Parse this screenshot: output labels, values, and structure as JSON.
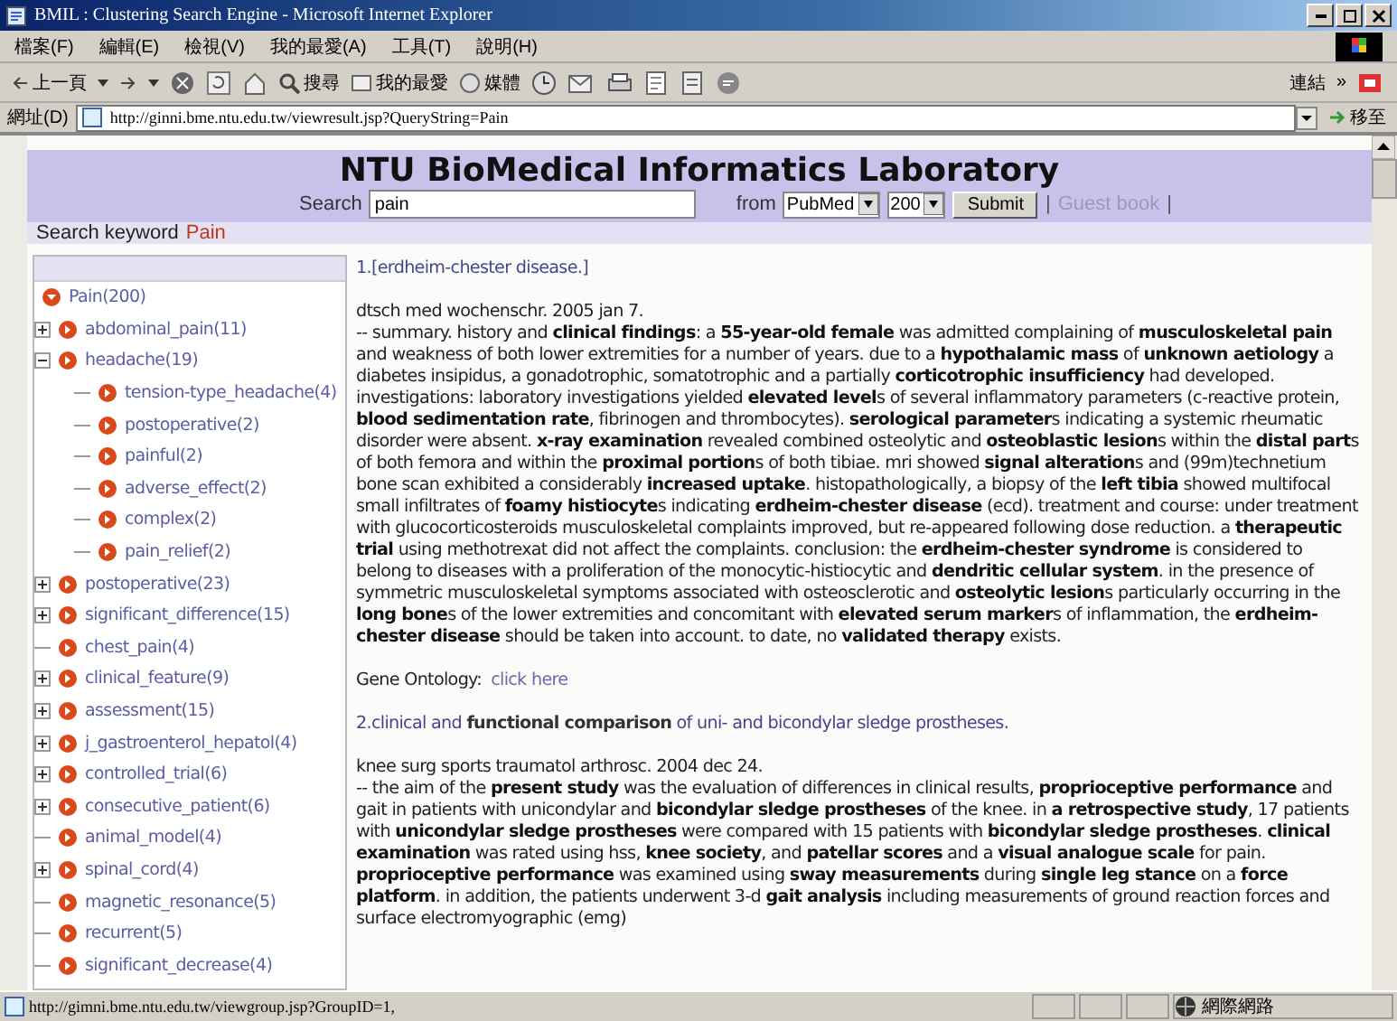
{
  "window": {
    "title": "BMIL : Clustering Search Engine - Microsoft Internet Explorer"
  },
  "menu": [
    "檔案(F)",
    "編輯(E)",
    "檢視(V)",
    "我的最愛(A)",
    "工具(T)",
    "說明(H)"
  ],
  "toolbar": {
    "back": "上一頁",
    "search": "搜尋",
    "favorites": "我的最愛",
    "media": "媒體",
    "links": "連結",
    "more": "»"
  },
  "address": {
    "label": "網址(D)",
    "url": "http://ginni.bme.ntu.edu.tw/viewresult.jsp?QueryString=Pain",
    "go": "移至"
  },
  "header": {
    "title": "NTU BioMedical Informatics Laboratory",
    "search_label": "Search",
    "search_value": "pain",
    "from_label": "from",
    "source": "PubMed",
    "count": "200",
    "submit": "Submit",
    "divider_left": "|",
    "guest_book": "Guest book",
    "divider_right": "|"
  },
  "keyword": {
    "label": "Search keyword",
    "value": "Pain"
  },
  "tree": [
    {
      "label": "Pain(200)",
      "kind": "root",
      "expanded": true,
      "children": [
        {
          "label": "abdominal_pain(11)",
          "kind": "group",
          "expanded": false
        },
        {
          "label": "headache(19)",
          "kind": "group",
          "expanded": true,
          "children": [
            {
              "label": "tension-type_headache(4)",
              "kind": "leaf"
            },
            {
              "label": "postoperative(2)",
              "kind": "leaf"
            },
            {
              "label": "painful(2)",
              "kind": "leaf"
            },
            {
              "label": "adverse_effect(2)",
              "kind": "leaf"
            },
            {
              "label": "complex(2)",
              "kind": "leaf"
            },
            {
              "label": "pain_relief(2)",
              "kind": "leaf"
            }
          ]
        },
        {
          "label": "postoperative(23)",
          "kind": "group",
          "expanded": false
        },
        {
          "label": "significant_difference(15)",
          "kind": "group",
          "expanded": false
        },
        {
          "label": "chest_pain(4)",
          "kind": "leaf"
        },
        {
          "label": "clinical_feature(9)",
          "kind": "group",
          "expanded": false
        },
        {
          "label": "assessment(15)",
          "kind": "group",
          "expanded": false
        },
        {
          "label": "j_gastroenterol_hepatol(4)",
          "kind": "group",
          "expanded": false
        },
        {
          "label": "controlled_trial(6)",
          "kind": "group",
          "expanded": false
        },
        {
          "label": "consecutive_patient(6)",
          "kind": "group",
          "expanded": false
        },
        {
          "label": "animal_model(4)",
          "kind": "leaf"
        },
        {
          "label": "spinal_cord(4)",
          "kind": "group",
          "expanded": false
        },
        {
          "label": "magnetic_resonance(5)",
          "kind": "leaf"
        },
        {
          "label": "recurrent(5)",
          "kind": "leaf"
        },
        {
          "label": "significant_decrease(4)",
          "kind": "leaf"
        }
      ]
    }
  ],
  "results": [
    {
      "title": "1.[erdheim-chester disease.]",
      "source": "dtsch med wochenschr. 2005 jan 7.",
      "abstract": "-- summary. history and **clinical findings**: a **55-year-old female** was admitted complaining of **musculoskeletal pain** and weakness of both lower extremities for a number of years. due to a **hypothalamic mass** of **unknown aetiology** a diabetes insipidus, a gonadotrophic, somatotrophic and a partially **corticotrophic insufficiency** had developed. investigations: laboratory investigations yielded **elevated level**s of several inflammatory parameters (c-reactive protein, **blood sedimentation rate**, fibrinogen and thrombocytes). **serological parameter**s indicating a systemic rheumatic disorder were absent. **x-ray examination** revealed combined osteolytic and **osteoblastic lesion**s within the **distal part**s of both femora and within the **proximal portion**s of both tibiae. mri showed **signal alteration**s and (99m)technetium bone scan exhibited a considerably **increased uptake**. histopathologically, a biopsy of the **left tibia** showed multifocal small infiltrates of **foamy histiocyte**s indicating **erdheim-chester disease** (ecd). treatment and course: under treatment with glucocorticosteroids musculoskeletal complaints improved, but re-appeared following dose reduction. a **therapeutic trial** using methotrexat did not affect the complaints. conclusion: the **erdheim-chester syndrome** is considered to belong to diseases with a proliferation of the monocytic-histiocytic and **dendritic cellular system**. in the presence of symmetric musculoskeletal symptoms associated with osteosclerotic and **osteolytic lesion**s particularly occurring in the **long bone**s of the lower extremities and concomitant with **elevated serum marker**s of inflammation, the **erdheim-chester disease** should be taken into account. to date, no **validated therapy** exists.",
      "ontology_label": "Gene Ontology:",
      "ontology_link": "click here"
    },
    {
      "title": "2.clinical and **functional comparison** of uni- and bicondylar sledge prostheses.",
      "source": "knee surg sports traumatol arthrosc. 2004 dec 24.",
      "abstract": "-- the aim of the **present study** was the evaluation of differences in clinical results, **proprioceptive performance** and gait in patients with unicondylar and **bicondylar sledge prostheses** of the knee. in **a retrospective study**, 17 patients with **unicondylar sledge prostheses** were compared with 15 patients with **bicondylar sledge prostheses**. **clinical examination** was rated using hss, **knee society**, and **patellar scores** and a **visual analogue scale** for pain. **proprioceptive performance** was examined using **sway measurements** during **single leg stance** on a **force platform**. in addition, the patients underwent 3-d **gait analysis** including measurements of ground reaction forces and surface electromyographic (emg)"
    }
  ],
  "status_bar": {
    "text": "http://gimni.bme.ntu.edu.tw/viewgroup.jsp?GroupID=1,",
    "zone": "網際網路"
  }
}
